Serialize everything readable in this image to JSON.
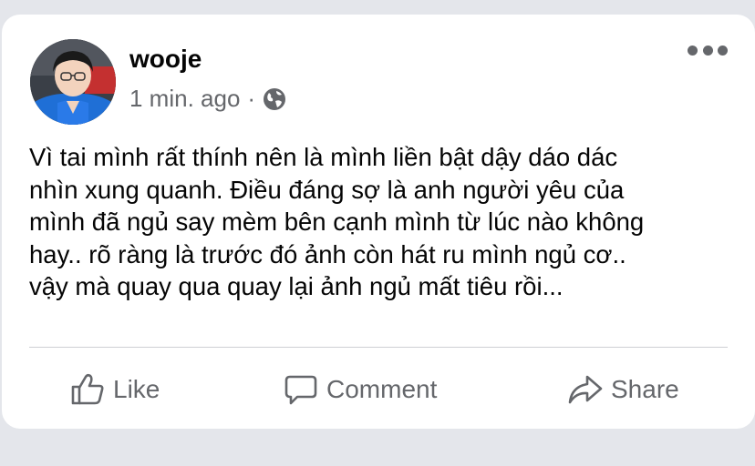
{
  "post": {
    "author": "wooje",
    "timestamp": "1 min. ago",
    "separator": "·",
    "privacy_icon": "globe-icon",
    "more_icon": "more-options-icon",
    "text_lines": [
      "Vì tai mình rất thính nên là mình liền bật dậy dáo dác",
      "nhìn xung quanh. Điều đáng sợ là anh người yêu của",
      "mình đã ngủ say mèm bên cạnh mình từ lúc nào không",
      "hay.. rõ ràng là trước đó ảnh còn hát ru mình ngủ cơ..",
      "vậy mà quay qua quay lại ảnh ngủ mất tiêu rồi..."
    ]
  },
  "actions": {
    "like_label": "Like",
    "comment_label": "Comment",
    "share_label": "Share"
  },
  "colors": {
    "page_background": "#e4e6eb",
    "card_background": "#ffffff",
    "secondary_text": "#65676b",
    "primary_text": "#050505",
    "divider": "#ced0d4"
  }
}
